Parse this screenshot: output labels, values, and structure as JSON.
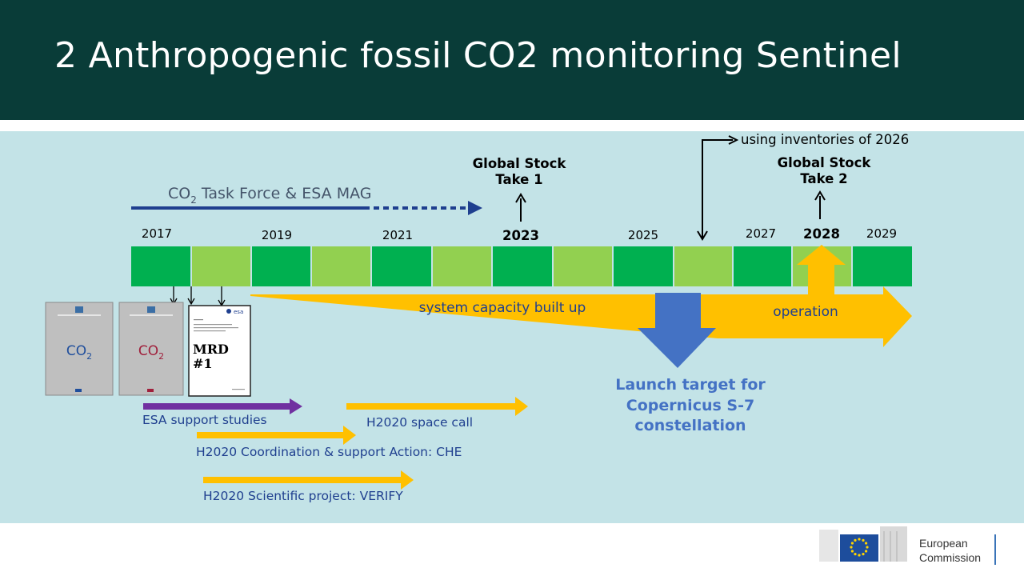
{
  "title": "2 Anthropogenic fossil CO2 monitoring Sentinel",
  "taskforce": {
    "prefix": "CO",
    "sub": "2",
    "suffix": " Task Force & ESA MAG"
  },
  "inventories_note": "using inventories of 2026",
  "gst1": {
    "line1": "Global Stock",
    "line2": "Take 1"
  },
  "gst2": {
    "line1": "Global Stock",
    "line2": "Take 2"
  },
  "years": {
    "y2017": "2017",
    "y2019": "2019",
    "y2021": "2021",
    "y2023": "2023",
    "y2025": "2025",
    "y2027": "2027",
    "y2028": "2028",
    "y2029": "2029"
  },
  "capacity_label": "system capacity built up",
  "operation_label": "operation",
  "launch": {
    "line1": "Launch target for",
    "line2": "Copernicus S-7",
    "line3": "constellation"
  },
  "docs": {
    "co2": "CO",
    "co2_sub": "2",
    "mrd_line1": "MRD",
    "mrd_line2": "#1",
    "esa": "esa"
  },
  "studies": {
    "esa_support": "ESA support studies",
    "space_call": "H2020 space call",
    "che": "H2020 Coordination & support Action: CHE",
    "verify": "H2020 Scientific project: VERIFY"
  },
  "footer": {
    "line1": "European",
    "line2": "Commission"
  },
  "colors": {
    "header": "#093c38",
    "panel": "#c3e3e7",
    "dark_green": "#00b050",
    "light_green": "#92d050",
    "orange": "#ffc000",
    "blue": "#4472c4",
    "navy": "#1f3f8f",
    "purple": "#7030a0"
  }
}
